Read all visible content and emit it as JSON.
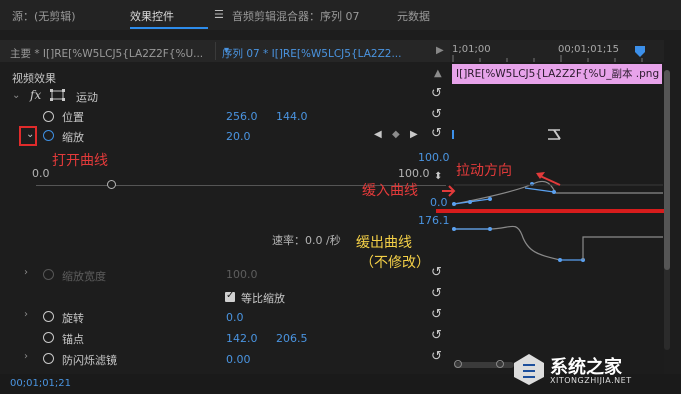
{
  "tabs": [
    {
      "label": "源：(无剪辑)"
    },
    {
      "label": "效果控件"
    },
    {
      "label": "音频剪辑混合器：序列 07"
    },
    {
      "label": "元数据"
    }
  ],
  "sequence": {
    "master": "主要 * I[]RE[%W5LCJ5{LA2Z2F{%U...",
    "seq": "序列 07 * I[]RE[%W5LCJ5{LA2Z2..."
  },
  "ruler": {
    "t1": "1;01;00",
    "t2": "00;01;01;15"
  },
  "clip_label": "I[]RE[%W5LCJ5{LA2Z2F{%U_副本 .png",
  "section_title": "视频效果",
  "fx_label": "运动",
  "props": {
    "position": {
      "label": "位置",
      "x": "256.0",
      "y": "144.0"
    },
    "scale": {
      "label": "缩放",
      "value": "20.0"
    },
    "graph_top_right": "100.0",
    "graph_top_left": "0.0",
    "graph_mid_right": "100.0",
    "rate_label": "速率：0.0 /秒",
    "scale_width": {
      "label": "缩放宽度",
      "value": "100.0"
    },
    "uniform_scale": {
      "label": "等比缩放"
    },
    "rotation": {
      "label": "旋转",
      "value": "0.0"
    },
    "anchor": {
      "label": "锚点",
      "x": "142.0",
      "y": "206.5"
    },
    "flicker": {
      "label": "防闪烁滤镜",
      "value": "0.00"
    }
  },
  "graph_values": {
    "top": "100.0",
    "zero": "0.0",
    "speed": "176.1"
  },
  "timecode": "00;01;01;21",
  "annotations": {
    "open_curve": "打开曲线",
    "pull_direction": "拉动方向",
    "ease_in": "缓入曲线",
    "ease_out": "缓出曲线",
    "ease_out_note": "（不修改）"
  },
  "watermark": {
    "brand": "系统之家",
    "url": "XITONGZHIJIA.NET"
  },
  "colors": {
    "accent": "#2d8ceb",
    "annotation_red": "#e23a3a",
    "annotation_yellow": "#f3cf47",
    "clip": "#e7a3ea"
  }
}
